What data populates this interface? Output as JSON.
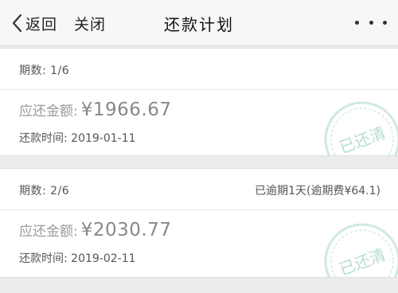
{
  "header": {
    "back_label": "返回",
    "close_label": "关闭",
    "title": "还款计划"
  },
  "installments": [
    {
      "period": "期数: 1/6",
      "overdue": "",
      "amount_label": "应还金额:",
      "amount": "¥1966.67",
      "due_time": "还款时间: 2019-01-11",
      "stamp": "已还清"
    },
    {
      "period": "期数: 2/6",
      "overdue": "已逾期1天(逾期费¥64.1)",
      "amount_label": "应还金额:",
      "amount": "¥2030.77",
      "due_time": "还款时间: 2019-02-11",
      "stamp": "已还清"
    }
  ],
  "colors": {
    "stamp": "#cfe9e0",
    "stamp_text": "#b7ddd0"
  },
  "icons": [
    "chevron-left-icon",
    "more-dots-icon",
    "paid-stamp-icon"
  ]
}
